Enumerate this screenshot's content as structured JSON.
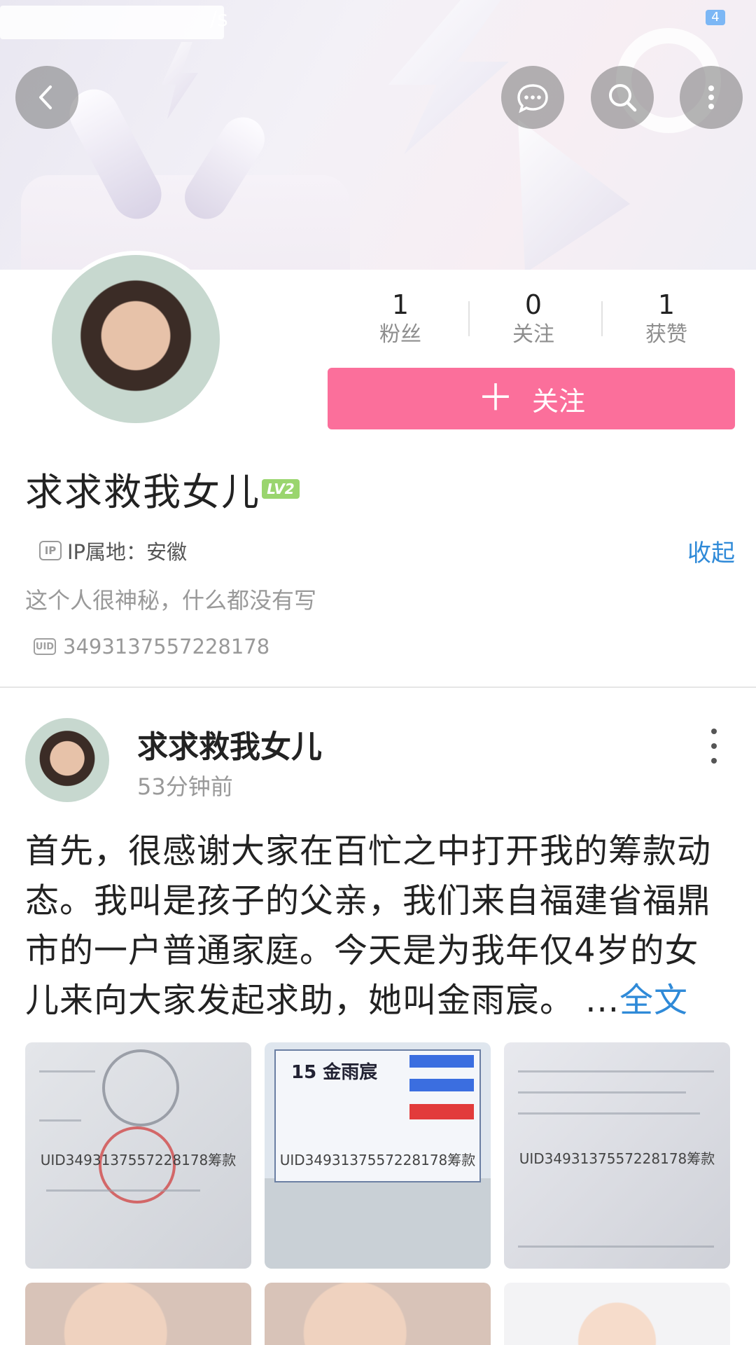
{
  "status_bar": {
    "speed": "/s",
    "battery": "4"
  },
  "header": {
    "back": "back-icon",
    "message": "chat-icon",
    "search": "search-icon",
    "more": "more-icon"
  },
  "profile": {
    "stats": [
      {
        "value": "1",
        "label": "粉丝"
      },
      {
        "value": "0",
        "label": "关注"
      },
      {
        "value": "1",
        "label": "获赞"
      }
    ],
    "follow_plus": "＋",
    "follow_label": "关注",
    "nickname": "求求救我女儿",
    "level": "LV2",
    "ip_icon": "IP",
    "ip_location": "IP属地：安徽",
    "collapse": "收起",
    "bio": "这个人很神秘，什么都没有写",
    "uid_icon": "UID",
    "uid": "3493137557228178"
  },
  "post": {
    "author": "求求救我女儿",
    "time": "53分钟前",
    "text": "首先，很感谢大家在百忙之中打开我的筹款动态。我叫是孩子的父亲，我们来自福建省福鼎市的一户普通家庭。今天是为我年仅4岁的女儿来向大家发起求助，她叫金雨宸。 ...",
    "full_text_link": "全文",
    "images": [
      {
        "watermark": "UID3493137557228178筹款"
      },
      {
        "watermark": "UID3493137557228178筹款",
        "title": "15  金雨宸"
      },
      {
        "watermark": "UID3493137557228178筹款"
      },
      {
        "watermark": ""
      },
      {
        "watermark": ""
      },
      {
        "watermark": ""
      }
    ]
  },
  "colors": {
    "follow_button": "#fb6f9b",
    "link": "#2f8ad8",
    "level_badge": "#9ad56e"
  }
}
